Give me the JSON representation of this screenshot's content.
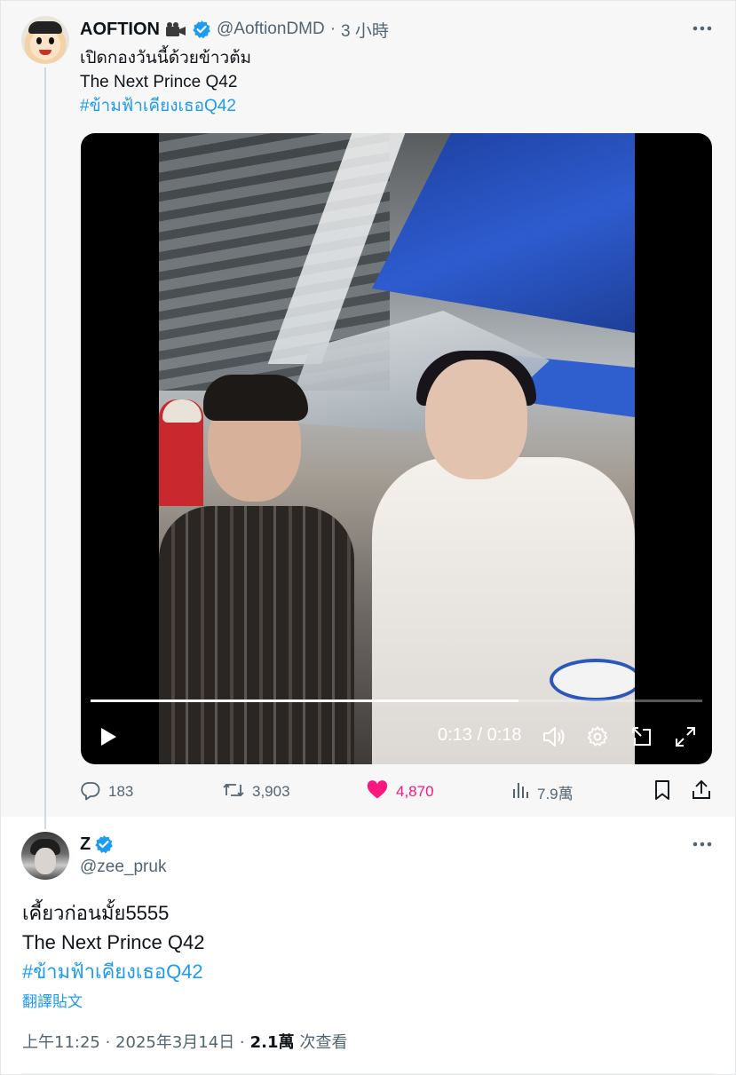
{
  "parent_tweet": {
    "display_name": "AOFTION",
    "handle": "@AoftionDMD",
    "separator": "·",
    "time_ago": "3 小時",
    "lines": [
      "เปิดกองวันนี้ด้วยข้าวต้ม",
      "The Next Prince Q42"
    ],
    "hashtag": "#ข้ามฟ้าเคียงเธอQ42",
    "video": {
      "current_time": "0:13",
      "duration": "0:18",
      "time_display": "0:13 / 0:18",
      "progress_fraction": 0.7
    },
    "actions": {
      "replies": "183",
      "reposts": "3,903",
      "likes": "4,870",
      "views": "7.9萬"
    }
  },
  "reply_tweet": {
    "display_name": "Z",
    "handle": "@zee_pruk",
    "lines": [
      "เคี้ยวก่อนมั้ย5555",
      "The Next Prince Q42"
    ],
    "hashtag": "#ข้ามฟ้าเคียงเธอQ42",
    "translate_label": "翻譯貼文",
    "timestamp": "上午11:25 · 2025年3月14日 ·",
    "views_count": "2.1萬",
    "views_label": "次查看"
  },
  "colors": {
    "accent": "#1d9bf0",
    "like": "#f91880",
    "muted": "#536471",
    "parent_bg": "#f7f7f7"
  }
}
